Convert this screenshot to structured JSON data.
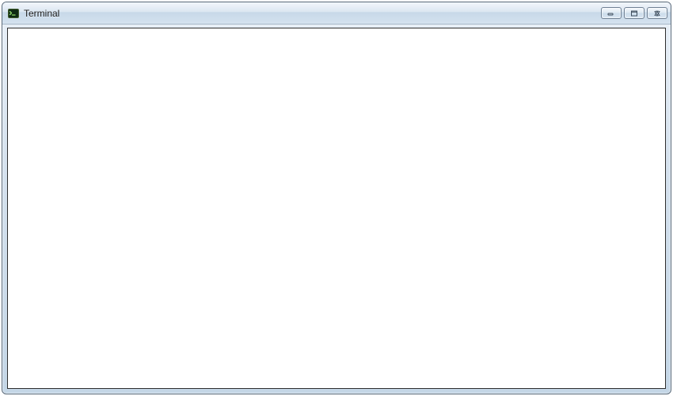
{
  "window": {
    "title": "Terminal",
    "content": "",
    "icons": {
      "app": "terminal-icon",
      "minimize": "minimize-icon",
      "maximize": "maximize-icon",
      "close": "close-icon"
    }
  }
}
